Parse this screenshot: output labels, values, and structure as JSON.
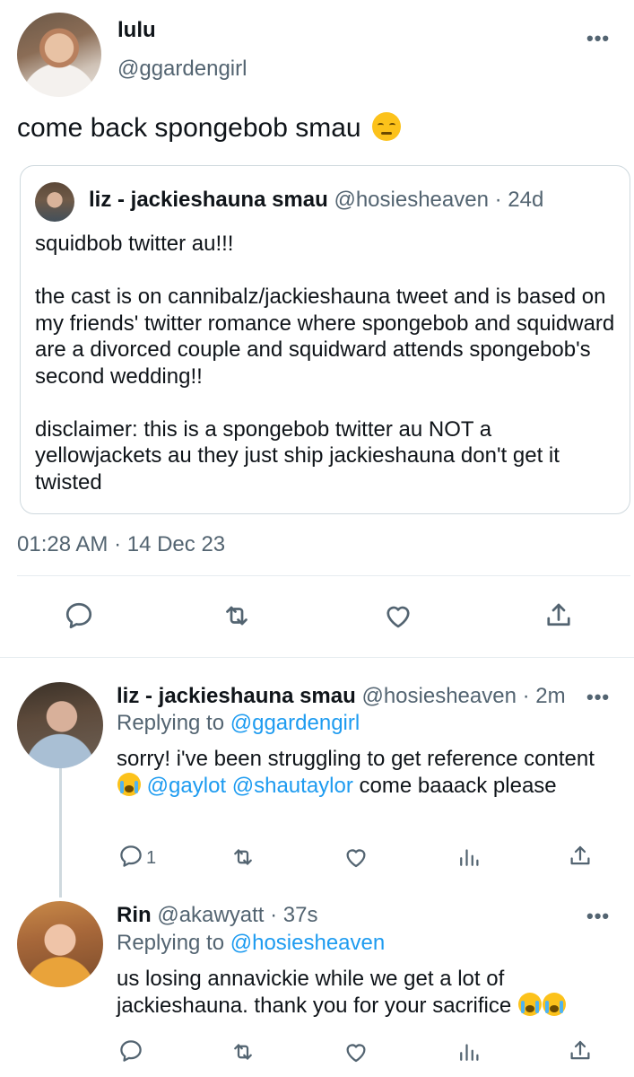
{
  "main_tweet": {
    "display_name": "lulu",
    "handle": "@ggardengirl",
    "text": "come back spongebob smau",
    "emoji": "pensive-face",
    "timestamp": "01:28 AM · 14 Dec 23",
    "quoted": {
      "display_name": "liz - jackieshauna smau",
      "handle": "@hosiesheaven",
      "time": "· 24d",
      "paragraphs": [
        "squidbob twitter au!!!",
        "the cast is on cannibalz/jackieshauna tweet and is based on my friends' twitter romance where spongebob and squidward are a divorced couple and squidward attends spongebob's second wedding!!",
        "disclaimer: this is a spongebob twitter au NOT a yellowjackets au they just ship jackieshauna don't get it twisted"
      ]
    }
  },
  "replies": [
    {
      "display_name": "liz - jackieshauna smau",
      "handle": "@hosiesheaven",
      "time": "· 2m",
      "replying_label": "Replying to",
      "replying_to": "@ggardengirl",
      "text_a": "sorry! i've been struggling to get reference content",
      "emoji": "loudly-crying-face",
      "mention_1": "@gaylot",
      "mention_2": "@shautaylor",
      "text_b": "come baaack please",
      "reply_count": "1"
    },
    {
      "display_name": "Rin",
      "handle": "@akawyatt",
      "time": "· 37s",
      "replying_label": "Replying to",
      "replying_to": "@hosiesheaven",
      "text": "us losing annavickie while we get a lot of jackieshauna. thank you for your sacrifice",
      "emoji": "loudly-crying-face"
    }
  ],
  "more_glyph": "•••",
  "colors": {
    "text": "#0f1419",
    "secondary": "#536471",
    "link": "#1d9bf0",
    "border": "#cfd9de"
  }
}
